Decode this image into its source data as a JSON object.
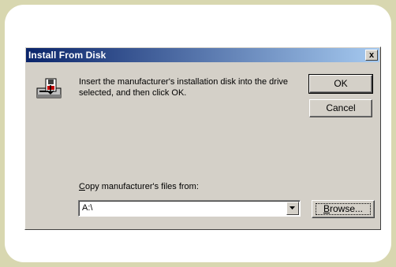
{
  "dialog": {
    "title": "Install From Disk",
    "close_glyph": "x",
    "message": "Insert the manufacturer's installation disk into the drive selected, and then click OK.",
    "ok_label": "OK",
    "cancel_label": "Cancel",
    "copy_label_accel": "C",
    "copy_label_rest": "opy manufacturer's files from:",
    "path_value": "A:\\",
    "browse_label_accel": "B",
    "browse_label_rest": "rowse..."
  },
  "icons": {
    "disk": "floppy-disk-drive-icon",
    "dropdown": "chevron-down-icon"
  },
  "colors": {
    "background": "#d8d7b0",
    "dialog_face": "#d4d0c8",
    "titlebar_start": "#0a246a",
    "titlebar_end": "#a6caf0"
  }
}
